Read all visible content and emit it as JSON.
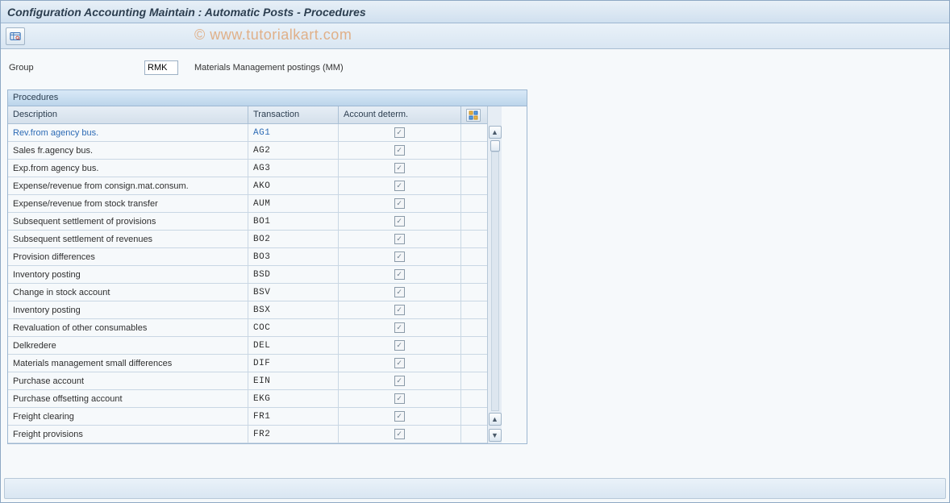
{
  "title": "Configuration Accounting Maintain : Automatic Posts - Procedures",
  "watermark": "© www.tutorialkart.com",
  "toolbar": {
    "overview_icon": "overview"
  },
  "group": {
    "label": "Group",
    "value": "RMK",
    "description": "Materials Management postings (MM)"
  },
  "panel": {
    "title": "Procedures",
    "columns": {
      "description": "Description",
      "transaction": "Transaction",
      "account_determ": "Account determ."
    },
    "rows": [
      {
        "desc": "Rev.from agency bus.",
        "trx": "AG1",
        "acc": true
      },
      {
        "desc": "Sales fr.agency bus.",
        "trx": "AG2",
        "acc": true
      },
      {
        "desc": "Exp.from agency bus.",
        "trx": "AG3",
        "acc": true
      },
      {
        "desc": "Expense/revenue from consign.mat.consum.",
        "trx": "AKO",
        "acc": true
      },
      {
        "desc": "Expense/revenue from stock transfer",
        "trx": "AUM",
        "acc": true
      },
      {
        "desc": "Subsequent settlement of provisions",
        "trx": "BO1",
        "acc": true
      },
      {
        "desc": "Subsequent settlement of revenues",
        "trx": "BO2",
        "acc": true
      },
      {
        "desc": "Provision differences",
        "trx": "BO3",
        "acc": true
      },
      {
        "desc": "Inventory posting",
        "trx": "BSD",
        "acc": true
      },
      {
        "desc": "Change in stock account",
        "trx": "BSV",
        "acc": true
      },
      {
        "desc": "Inventory posting",
        "trx": "BSX",
        "acc": true
      },
      {
        "desc": "Revaluation of other consumables",
        "trx": "COC",
        "acc": true
      },
      {
        "desc": "Delkredere",
        "trx": "DEL",
        "acc": true
      },
      {
        "desc": "Materials management small differences",
        "trx": "DIF",
        "acc": true
      },
      {
        "desc": "Purchase account",
        "trx": "EIN",
        "acc": true
      },
      {
        "desc": "Purchase offsetting account",
        "trx": "EKG",
        "acc": true
      },
      {
        "desc": "Freight clearing",
        "trx": "FR1",
        "acc": true
      },
      {
        "desc": "Freight provisions",
        "trx": "FR2",
        "acc": true
      }
    ]
  }
}
